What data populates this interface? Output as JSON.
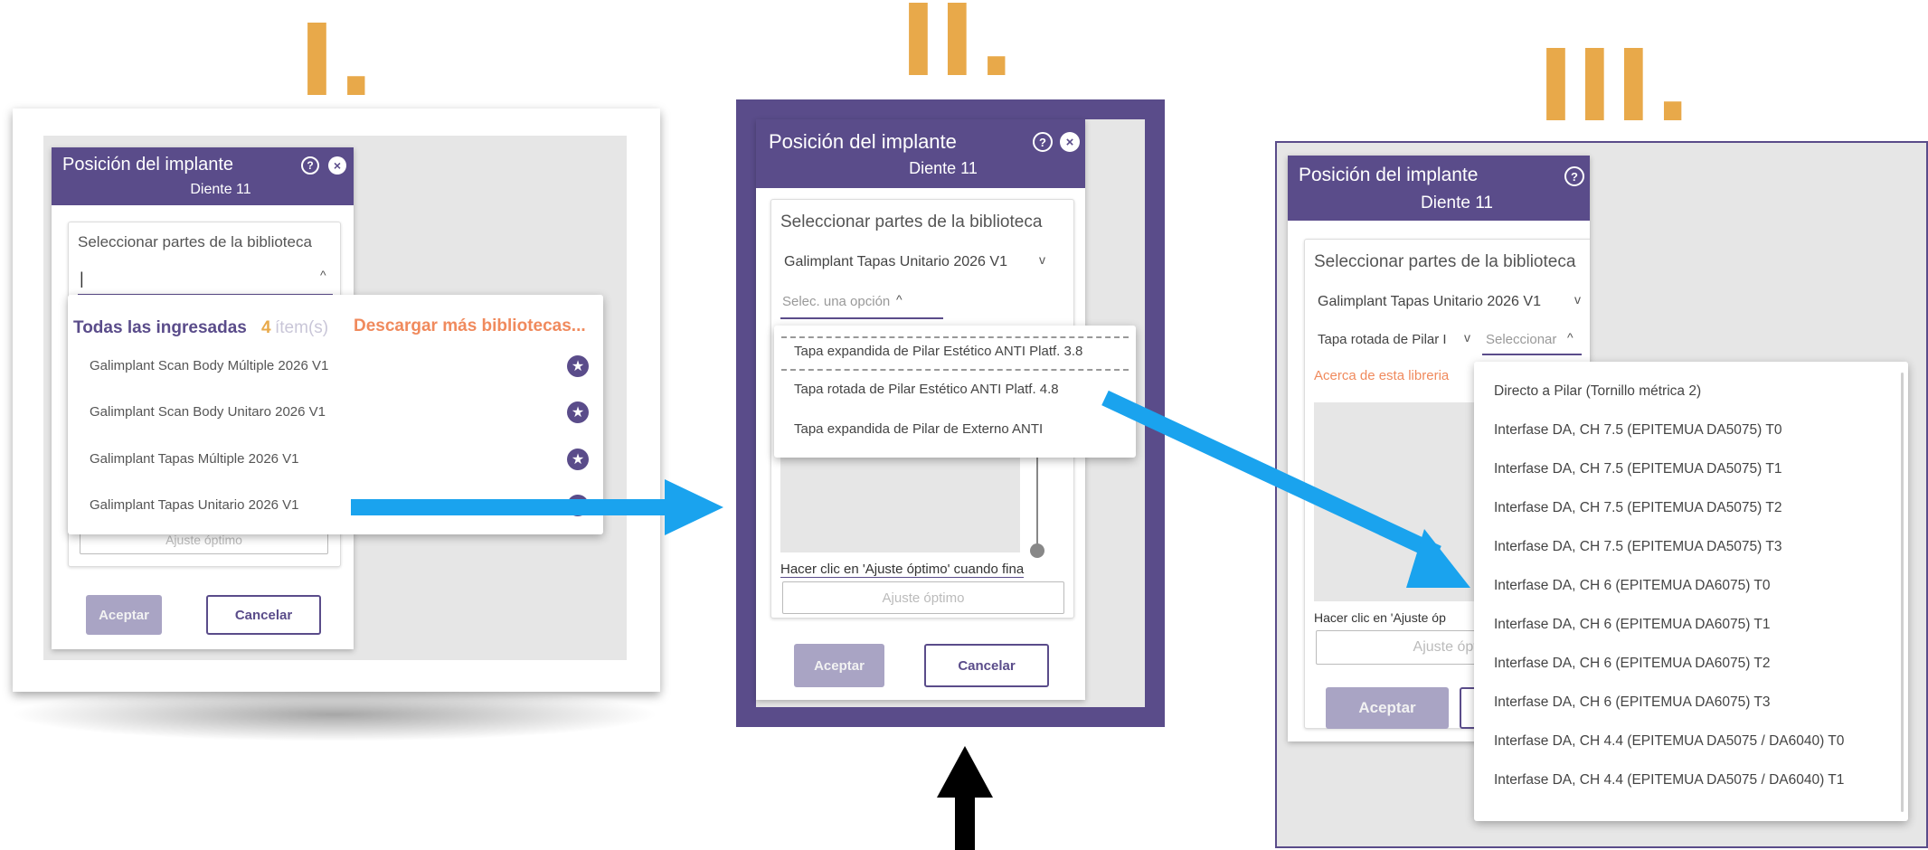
{
  "steps": {
    "one": "I.",
    "two": "II.",
    "three": "III."
  },
  "colors": {
    "header": "#5a4c8a",
    "label": "#e8a94a",
    "arrow": "#1aa3ee",
    "download_link": "#f08a5d"
  },
  "dialog": {
    "title": "Posición del implante",
    "subtitle": "Diente 11",
    "help_icon": "help-circle-icon",
    "close_icon": "close-circle-icon",
    "section_label": "Seleccionar partes de la biblioteca",
    "accept": "Aceptar",
    "cancel": "Cancelar",
    "best_fit": "Ajuste óptimo",
    "best_fit_hint": "Hacer clic en 'Ajuste óptimo' cuando fina",
    "best_fit_hint_short": "Hacer clic en 'Ajuste óp",
    "about_library": "Acerca de esta libreria"
  },
  "panel1": {
    "search_value": "|",
    "all_label": "Todas las ingresadas",
    "count": "4",
    "items_label": "ítem(s)",
    "download_more": "Descargar más bibliotecas...",
    "libraries": [
      "Galimplant Scan Body Múltiple 2026 V1",
      "Galimplant Scan Body Unitaro 2026 V1",
      "Galimplant Tapas Múltiple 2026 V1",
      "Galimplant Tapas Unitario 2026 V1"
    ]
  },
  "panel2": {
    "library_select": "Galimplant Tapas Unitario 2026 V1",
    "option_placeholder": "Selec. una opción",
    "options": [
      "Tapa expandida de Pilar Estético ANTI Platf. 3.8",
      "Tapa rotada de Pilar Estético ANTI Platf. 4.8",
      "Tapa expandida de Pilar de Externo ANTI"
    ]
  },
  "panel3": {
    "library_select": "Galimplant Tapas Unitario 2026 V1",
    "part_select": "Tapa rotada de Pilar I",
    "part_placeholder": "Seleccionar",
    "options": [
      "Directo a Pilar (Tornillo métrica 2)",
      "Interfase DA, CH 7.5 (EPITEMUA DA5075) T0",
      "Interfase DA, CH 7.5 (EPITEMUA DA5075) T1",
      "Interfase DA, CH 7.5 (EPITEMUA DA5075) T2",
      "Interfase DA, CH 7.5 (EPITEMUA DA5075) T3",
      "Interfase DA, CH 6 (EPITEMUA DA6075) T0",
      "Interfase DA, CH 6 (EPITEMUA DA6075) T1",
      "Interfase DA, CH 6 (EPITEMUA DA6075) T2",
      "Interfase DA, CH 6 (EPITEMUA DA6075) T3",
      "Interfase DA, CH 4.4 (EPITEMUA DA5075 / DA6040) T0",
      "Interfase DA, CH 4.4 (EPITEMUA DA5075 / DA6040) T1"
    ]
  }
}
